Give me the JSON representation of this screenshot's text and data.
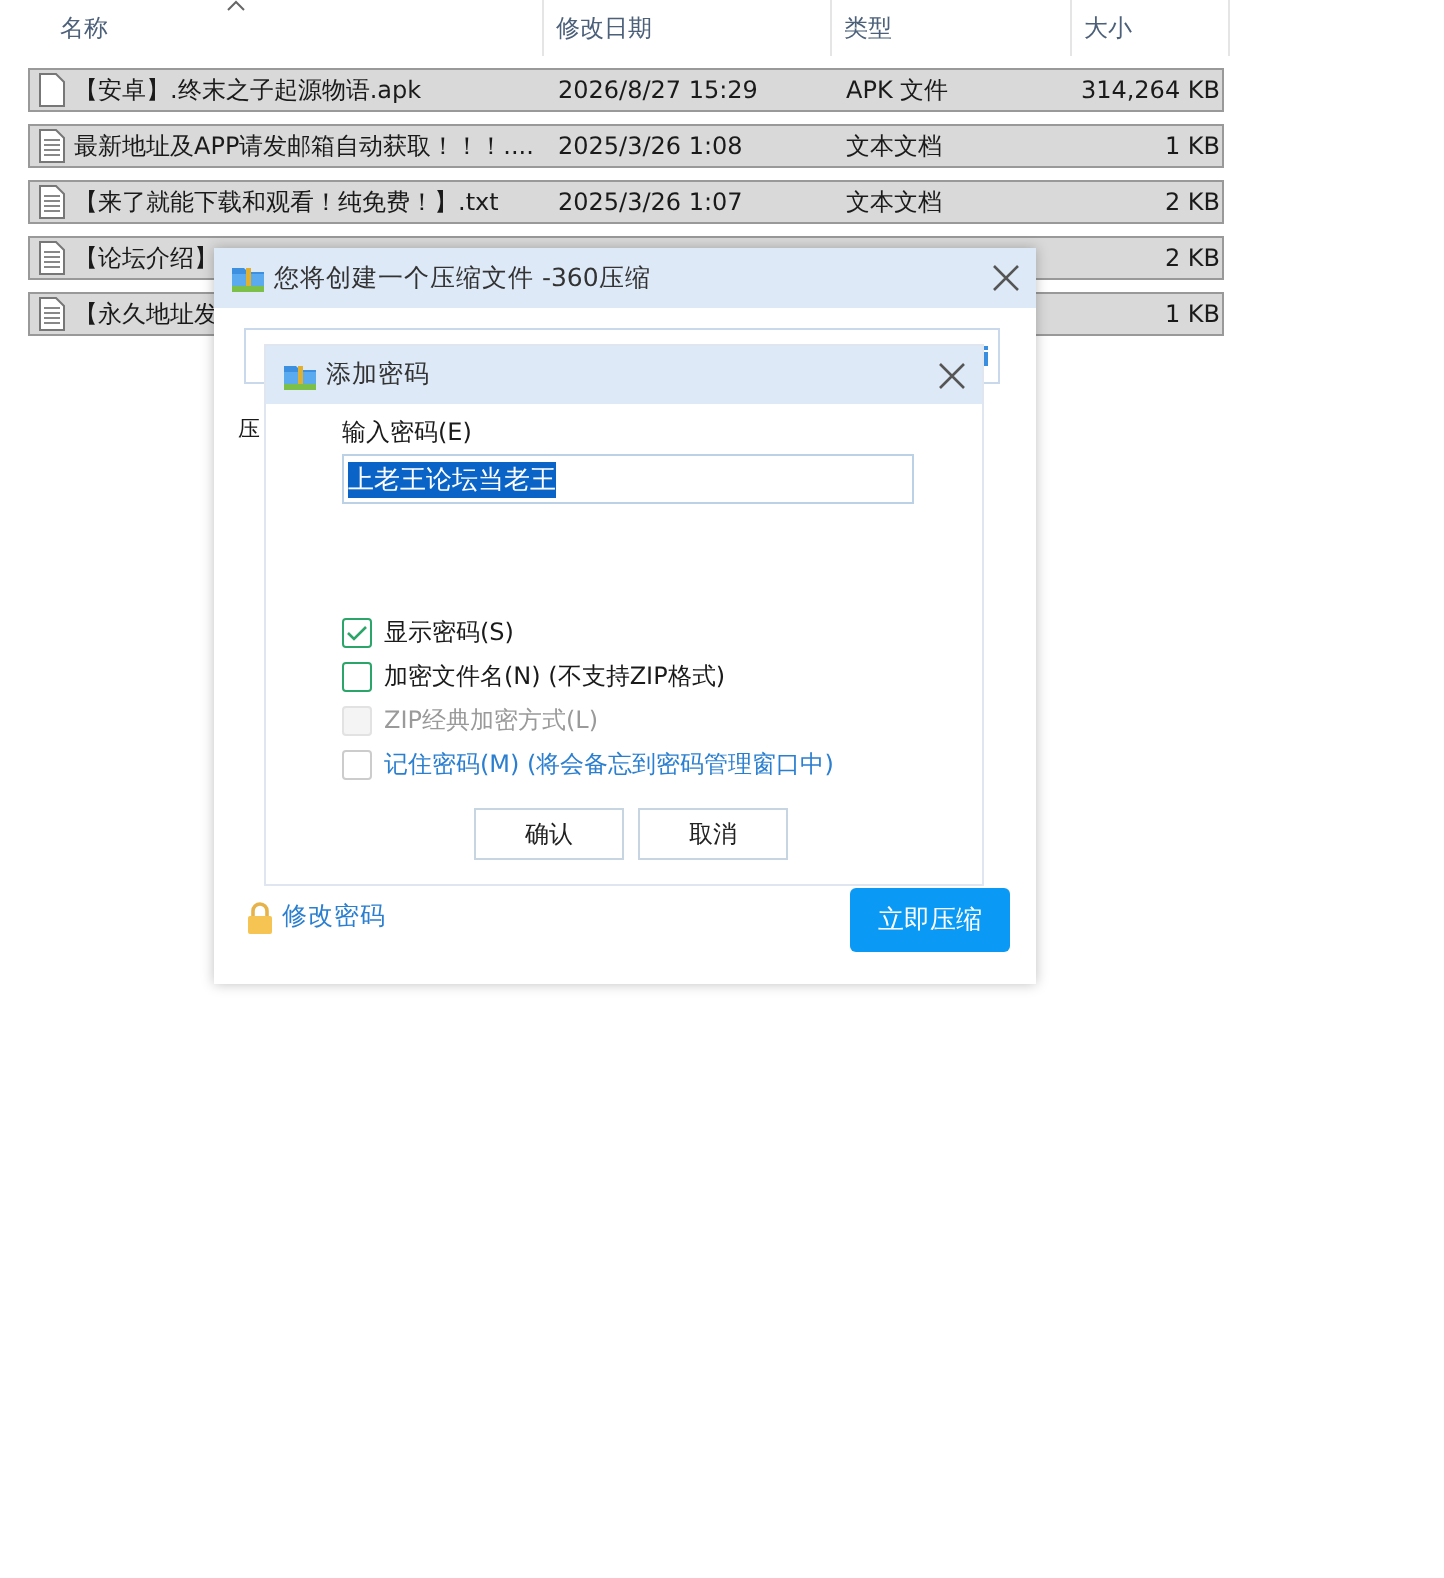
{
  "file_list": {
    "columns": [
      {
        "label": "名称",
        "sorted": true
      },
      {
        "label": "修改日期",
        "sorted": false
      },
      {
        "label": "类型",
        "sorted": false
      },
      {
        "label": "大小",
        "sorted": false
      }
    ],
    "rows": [
      {
        "name": "【安卓】.终末之子起源物语.apk",
        "date": "2026/8/27 15:29",
        "type": "APK 文件",
        "size": "314,264 KB",
        "kind": "file",
        "selected": true
      },
      {
        "name": "最新地址及APP请发邮箱自动获取！！！....",
        "date": "2025/3/26 1:08",
        "type": "文本文档",
        "size": "1 KB",
        "kind": "text",
        "selected": true
      },
      {
        "name": "【来了就能下载和观看！纯免费！】.txt",
        "date": "2025/3/26 1:07",
        "type": "文本文档",
        "size": "2 KB",
        "kind": "text",
        "selected": true
      },
      {
        "name": "【论坛介绍】",
        "size": "2 KB",
        "kind": "text",
        "selected": true
      },
      {
        "name": "【永久地址发",
        "size": "1 KB",
        "kind": "text",
        "selected": true
      }
    ]
  },
  "compress_dialog": {
    "title": "您将创建一个压缩文件 -360压缩",
    "label_partial": "压",
    "change_password_link": "修改密码",
    "compress_button": "立即压缩"
  },
  "password_dialog": {
    "title": "添加密码",
    "password_label": "输入密码(E)",
    "password_value": "上老王论坛当老王",
    "options": [
      {
        "label": "显示密码(S)",
        "checked": true,
        "disabled": false,
        "link": false
      },
      {
        "label": "加密文件名(N) (不支持ZIP格式)",
        "checked": false,
        "disabled": false,
        "link": false
      },
      {
        "label": "ZIP经典加密方式(L)",
        "checked": false,
        "disabled": true,
        "link": false
      },
      {
        "label": "记住密码(M) (将会备忘到密码管理窗口中)",
        "checked": false,
        "disabled": false,
        "link": true
      }
    ],
    "buttons": [
      "确认",
      "取消"
    ]
  }
}
